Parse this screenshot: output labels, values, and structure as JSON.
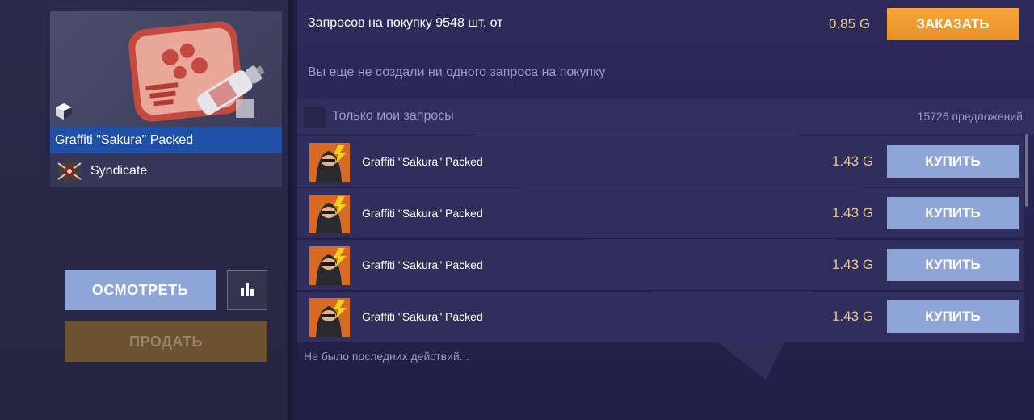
{
  "item": {
    "name": "Graffiti \"Sakura\" Packed",
    "collection": "Syndicate",
    "icons": {
      "type": "cube-icon",
      "collection": "syndicate-emblem-icon"
    }
  },
  "actions": {
    "inspect_label": "ОСМОТРЕТЬ",
    "stats_icon": "bar-chart-icon",
    "sell_label": "ПРОДАТЬ"
  },
  "buy_orders": {
    "title": "Запросов на покупку 9548 шт. от",
    "price": "0.85",
    "currency_icon": "gold-g-icon",
    "order_label": "ЗАКАЗАТЬ",
    "empty_text": "Вы еще не создали ни одного запроса на покупку"
  },
  "listings": {
    "filter_label": "Только мои запросы",
    "offers_count": "15726 предложений",
    "rows": [
      {
        "name": "Graffiti \"Sakura\" Packed",
        "price": "1.43",
        "buy_label": "КУПИТЬ"
      },
      {
        "name": "Graffiti \"Sakura\" Packed",
        "price": "1.43",
        "buy_label": "КУПИТЬ"
      },
      {
        "name": "Graffiti \"Sakura\" Packed",
        "price": "1.43",
        "buy_label": "КУПИТЬ"
      },
      {
        "name": "Graffiti \"Sakura\" Packed",
        "price": "1.43",
        "buy_label": "КУПИТЬ"
      }
    ]
  },
  "recent_actions_text": "Не было последних действий...",
  "colors": {
    "accent_orange": "#f7a736",
    "button_blue": "#8da5d8",
    "price_gold": "#e8c98b",
    "selected_blue": "#1f4fa6"
  }
}
